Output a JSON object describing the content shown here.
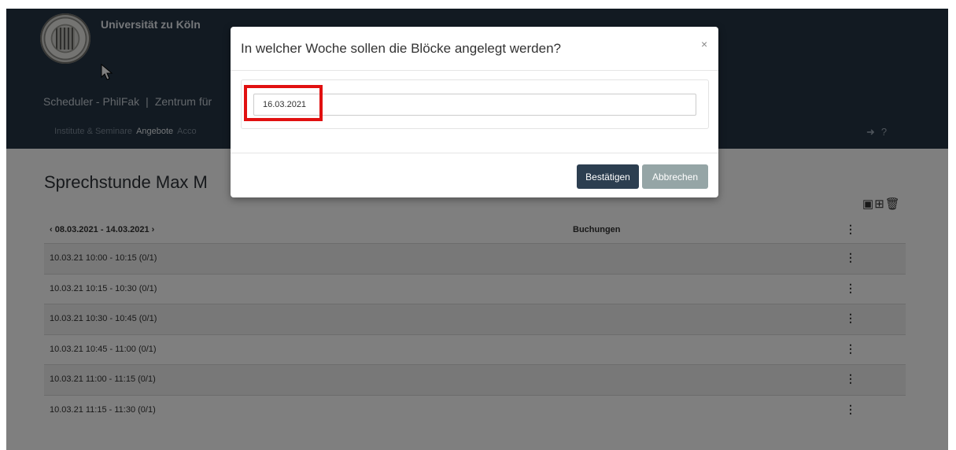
{
  "header": {
    "university_name": "Universität zu Köln",
    "breadcrumb_app": "Scheduler - PhilFak",
    "breadcrumb_separator": "|",
    "breadcrumb_center": "Zentrum für",
    "nav": [
      "Institute & Seminare",
      "Angebote",
      "Acco"
    ],
    "nav_active": "Angebote",
    "icons": [
      "logout-icon",
      "help-icon"
    ]
  },
  "page": {
    "title": "Sprechstunde Max M",
    "toolbar_icons": [
      "calendar-icon",
      "calendar-add-icon",
      "trash-icon"
    ]
  },
  "table": {
    "week_range": "‹ 08.03.2021 - 14.03.2021 ›",
    "col_bookings": "Buchungen",
    "rows": [
      {
        "slot": "10.03.21 10:00 - 10:15 (0/1)"
      },
      {
        "slot": "10.03.21 10:15 - 10:30 (0/1)"
      },
      {
        "slot": "10.03.21 10:30 - 10:45 (0/1)"
      },
      {
        "slot": "10.03.21 10:45 - 11:00 (0/1)"
      },
      {
        "slot": "10.03.21 11:00 - 11:15 (0/1)"
      },
      {
        "slot": "10.03.21 11:15 - 11:30 (0/1)"
      }
    ]
  },
  "modal": {
    "title": "In welcher Woche sollen die Blöcke angelegt werden?",
    "close": "×",
    "date_value": "16.03.2021",
    "confirm_label": "Bestätigen",
    "cancel_label": "Abbrechen"
  },
  "colors": {
    "header_bg": "#253545",
    "confirm_btn": "#2c3e50",
    "cancel_btn": "#95a5a6",
    "highlight": "#e11010"
  }
}
